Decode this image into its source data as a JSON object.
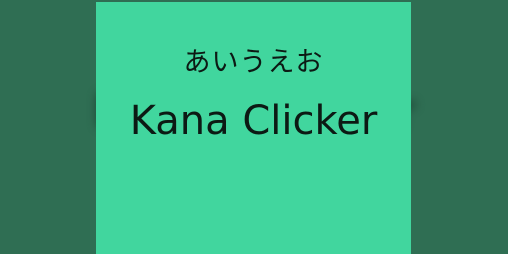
{
  "banner": {
    "kana": "あいうえお",
    "title": "Kana Clicker"
  },
  "colors": {
    "card_background": "#41d69e",
    "backdrop": "#2f6e53",
    "text": "#0c1a14"
  }
}
